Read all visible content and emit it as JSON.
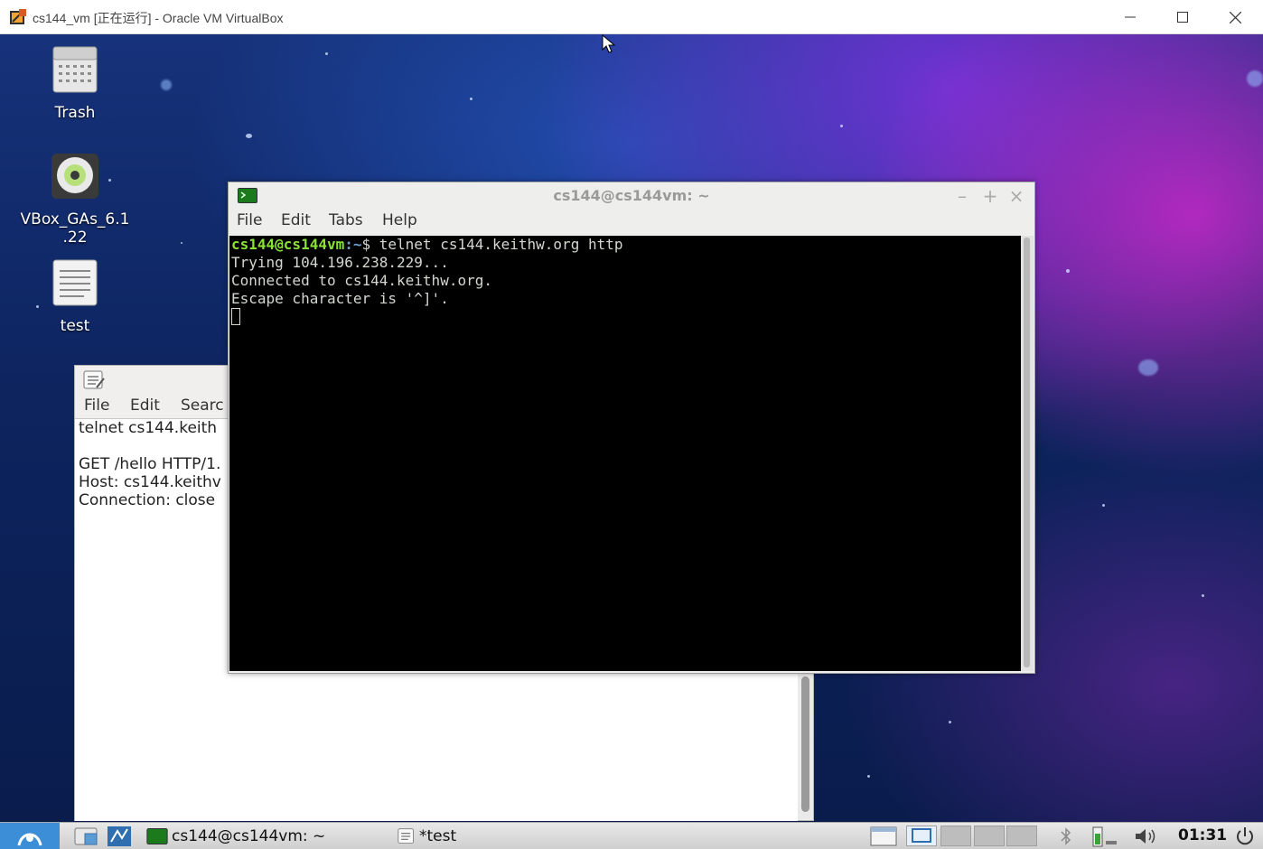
{
  "host": {
    "title": "cs144_vm [正在运行] - Oracle VM VirtualBox",
    "minimize_icon": "minimize-icon",
    "maximize_icon": "maximize-icon",
    "close_icon": "close-icon"
  },
  "desktop_icons": [
    {
      "label": "Trash",
      "icon": "trash-icon"
    },
    {
      "label": "VBox_GAs_6.1.22",
      "label_line1": "VBox_GAs_6.1",
      "label_line2": ".22",
      "icon": "disc-icon"
    },
    {
      "label": "test",
      "icon": "text-file-icon"
    }
  ],
  "editor": {
    "menu": [
      "File",
      "Edit",
      "Searc"
    ],
    "lines": [
      "telnet cs144.keith",
      "",
      "GET /hello HTTP/1.",
      "Host: cs144.keithv",
      "Connection: close"
    ]
  },
  "terminal": {
    "title": "cs144@cs144vm: ~",
    "menu": [
      "File",
      "Edit",
      "Tabs",
      "Help"
    ],
    "prompt_user": "cs144@cs144vm",
    "prompt_path": ":~",
    "prompt_symbol": "$ ",
    "command": "telnet cs144.keithw.org http",
    "output": [
      "Trying 104.196.238.229...",
      "Connected to cs144.keithw.org.",
      "Escape character is '^]'."
    ]
  },
  "taskbar": {
    "tasks": [
      {
        "label": "cs144@cs144vm: ~",
        "icon": "terminal-icon"
      },
      {
        "label": "*test",
        "icon": "text-editor-icon"
      }
    ],
    "clock": "01:31"
  },
  "colors": {
    "prompt_user": "#8ae234",
    "prompt_path": "#729fcf",
    "terminal_bg": "#000000",
    "taskbar_accent": "#3c8fd6"
  }
}
